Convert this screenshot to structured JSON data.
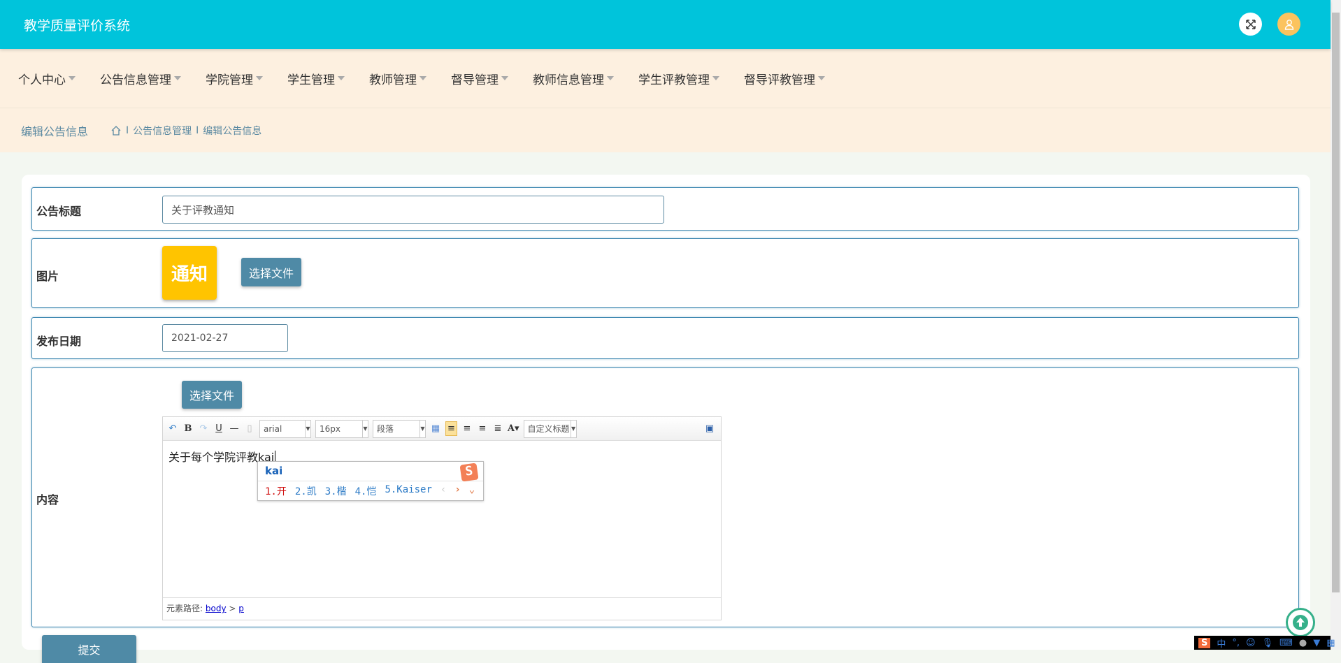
{
  "header": {
    "title": "教学质量评价系统",
    "fullscreen_icon": "expand-icon",
    "user_icon": "user-icon"
  },
  "nav": {
    "items": [
      "个人中心",
      "公告信息管理",
      "学院管理",
      "学生管理",
      "教师管理",
      "督导管理",
      "教师信息管理",
      "学生评教管理",
      "督导评教管理"
    ]
  },
  "breadcrumb": {
    "page_title": "编辑公告信息",
    "sep": "I",
    "items": [
      "公告信息管理",
      "编辑公告信息"
    ]
  },
  "form": {
    "title_label": "公告标题",
    "title_value": "关于评教通知",
    "image_label": "图片",
    "image_text": "通知",
    "choose_file": "选择文件",
    "date_label": "发布日期",
    "date_value": "2021-02-27",
    "content_label": "内容",
    "content_choose_file": "选择文件",
    "submit": "提交"
  },
  "editor": {
    "font": "arial",
    "size": "16px",
    "paragraph": "段落",
    "heading": "自定义标题",
    "content": "关于每个学院评教kai",
    "path_label": "元素路径:",
    "path": [
      "body",
      "p"
    ],
    "path_sep": ">"
  },
  "ime": {
    "input": "kai",
    "candidates": [
      "1.开",
      "2.凯",
      "3.楷",
      "4.恺",
      "5.Kaiser"
    ],
    "tray": [
      "中",
      "°,",
      "☺"
    ]
  },
  "colors": {
    "header": "#00c4db",
    "nav": "#fdf0e0",
    "button": "#4f8aa6",
    "border": "#3c86b0"
  }
}
